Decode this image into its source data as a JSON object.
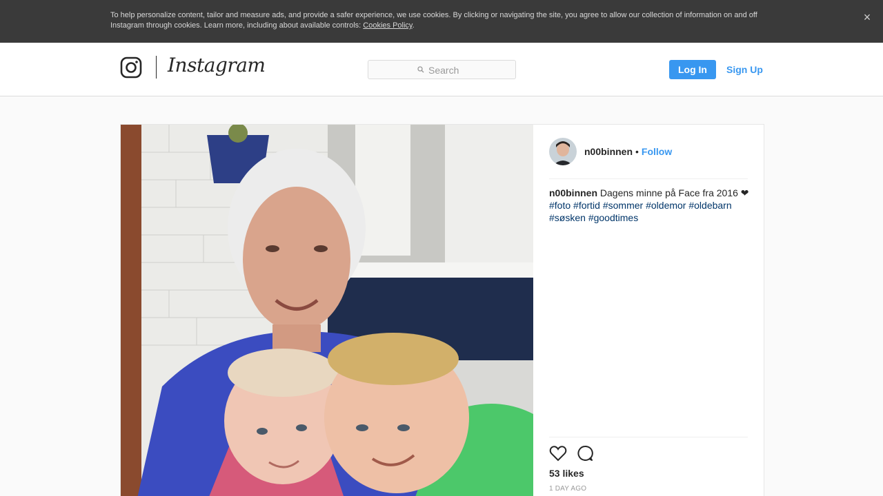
{
  "cookie_banner": {
    "text": "To help personalize content, tailor and measure ads, and provide a safer experience, we use cookies. By clicking or navigating the site, you agree to allow our collection of information on and off Instagram through cookies. Learn more, including about available controls: ",
    "link_label": "Cookies Policy",
    "trailing": ".",
    "close_symbol": "×"
  },
  "header": {
    "wordmark": "Instagram",
    "search_placeholder": "Search",
    "login_label": "Log In",
    "signup_label": "Sign Up"
  },
  "post": {
    "owner": "n00binnen",
    "separator": "•",
    "follow_label": "Follow",
    "caption": {
      "user": "n00binnen",
      "text": " Dagens minne på Face fra 2016 ❤ ",
      "tags": [
        "#foto",
        "#fortid",
        "#sommer",
        "#oldemor",
        "#oldebarn",
        "#søsken",
        "#goodtimes"
      ]
    },
    "likes": "53 likes",
    "time_ago": "1 DAY AGO"
  },
  "colors": {
    "accent": "#3897f0",
    "banner_bg": "#3a3a3a",
    "hashtag": "#003569"
  },
  "icons": [
    "instagram-glyph-icon",
    "search-icon",
    "close-icon",
    "heart-icon",
    "comment-icon"
  ]
}
